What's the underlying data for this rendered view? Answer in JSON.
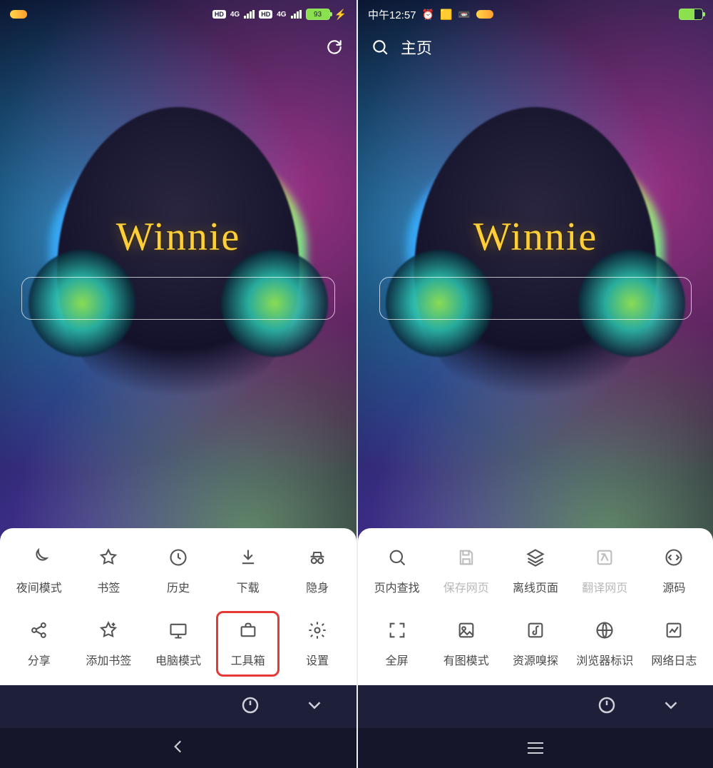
{
  "left": {
    "status": {
      "battery_text": "93",
      "net_label_1": "4G",
      "net_label_2": "4G",
      "hd1": "HD",
      "hd2": "HD"
    },
    "wallpaper_text": "Winnie",
    "menu_row1": [
      {
        "key": "night-mode",
        "label": "夜间模式",
        "icon": "moon"
      },
      {
        "key": "bookmarks",
        "label": "书签",
        "icon": "star"
      },
      {
        "key": "history",
        "label": "历史",
        "icon": "clock"
      },
      {
        "key": "download",
        "label": "下载",
        "icon": "download"
      },
      {
        "key": "incognito",
        "label": "隐身",
        "icon": "incognito"
      }
    ],
    "menu_row2": [
      {
        "key": "share",
        "label": "分享",
        "icon": "share"
      },
      {
        "key": "add-bookmark",
        "label": "添加书签",
        "icon": "star-plus"
      },
      {
        "key": "desktop-mode",
        "label": "电脑模式",
        "icon": "monitor"
      },
      {
        "key": "toolbox",
        "label": "工具箱",
        "icon": "briefcase",
        "highlight": true
      },
      {
        "key": "settings",
        "label": "设置",
        "icon": "gear"
      }
    ]
  },
  "right": {
    "status": {
      "time": "中午12:57"
    },
    "header_title": "主页",
    "wallpaper_text": "Winnie",
    "menu_row1": [
      {
        "key": "find-in-page",
        "label": "页内查找",
        "icon": "search-chat"
      },
      {
        "key": "save-page",
        "label": "保存网页",
        "icon": "save",
        "disabled": true
      },
      {
        "key": "offline-pages",
        "label": "离线页面",
        "icon": "layers"
      },
      {
        "key": "translate",
        "label": "翻译网页",
        "icon": "translate",
        "disabled": true
      },
      {
        "key": "source-code",
        "label": "源码",
        "icon": "code"
      }
    ],
    "menu_row2": [
      {
        "key": "fullscreen",
        "label": "全屏",
        "icon": "fullscreen"
      },
      {
        "key": "image-mode",
        "label": "有图模式",
        "icon": "image"
      },
      {
        "key": "sniffer",
        "label": "资源嗅探",
        "icon": "music-note"
      },
      {
        "key": "ua-string",
        "label": "浏览器标识",
        "icon": "globe"
      },
      {
        "key": "net-log",
        "label": "网络日志",
        "icon": "netlog"
      }
    ]
  }
}
